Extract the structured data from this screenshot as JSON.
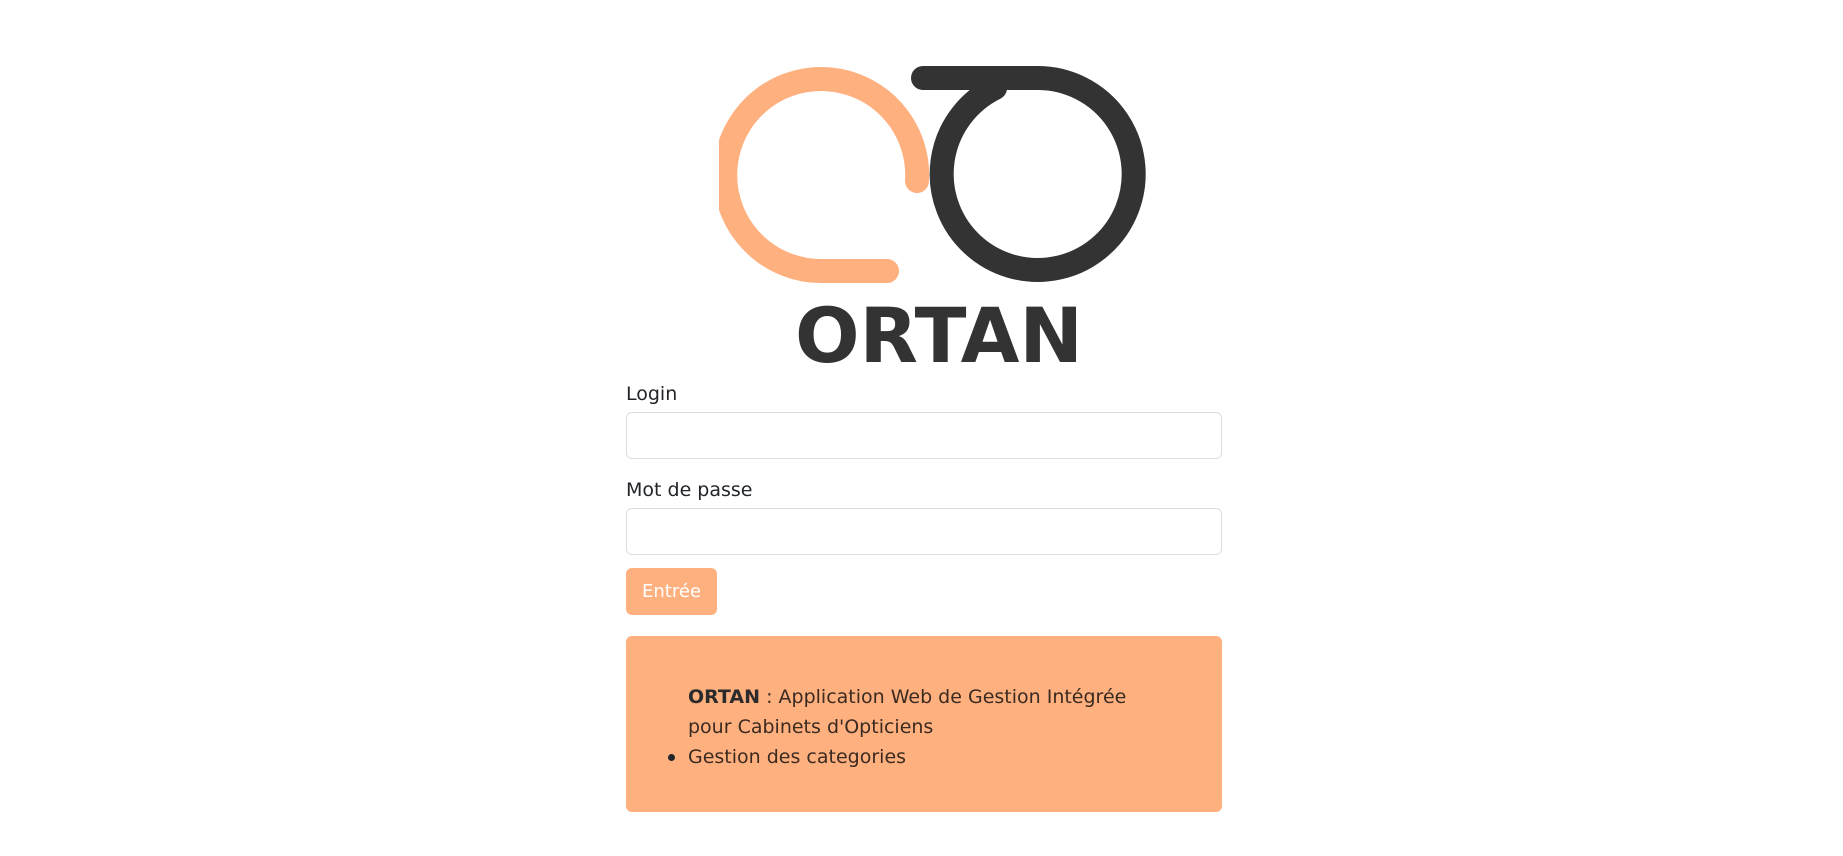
{
  "brand": {
    "name": "ORTAN",
    "colors": {
      "accent": "#ffb07f",
      "dark": "#333333"
    }
  },
  "form": {
    "login_label": "Login",
    "login_value": "",
    "password_label": "Mot de passe",
    "password_value": "",
    "submit_label": "Entrée"
  },
  "info": {
    "title": "ORTAN",
    "description": " : Application Web de Gestion Intégrée pour Cabinets d'Opticiens",
    "items": [
      "Gestion des categories"
    ]
  }
}
